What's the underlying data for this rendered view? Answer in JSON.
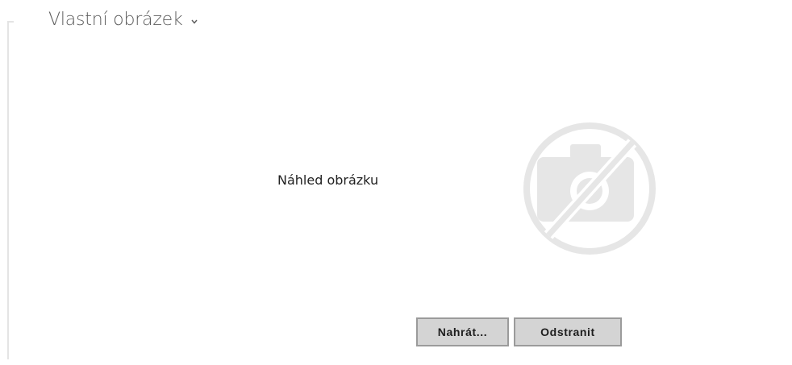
{
  "section": {
    "title": "Vlastní obrázek",
    "collapse_icon": "chevron-down-icon"
  },
  "preview": {
    "label": "Náhled obrázku",
    "placeholder_icon": "no-image-camera-icon"
  },
  "actions": {
    "upload_label": "Nahrát...",
    "remove_label": "Odstranit"
  },
  "colors": {
    "title_text": "#5c5c5c",
    "button_background": "#d4d4d4",
    "button_border": "#9b9b9b",
    "placeholder_icon": "#e6e6e6"
  }
}
